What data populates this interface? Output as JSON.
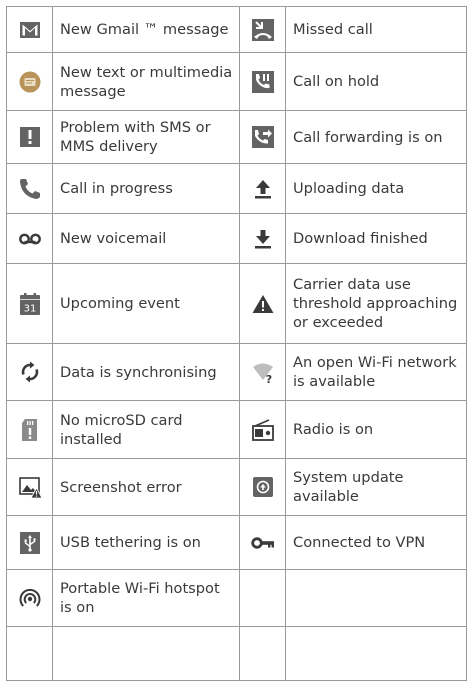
{
  "rows": [
    {
      "left": {
        "icon": "gmail-envelope-icon",
        "label": "New Gmail ™ message"
      },
      "right": {
        "icon": "missed-call-icon",
        "label": "Missed call"
      }
    },
    {
      "left": {
        "icon": "text-message-bubble-icon",
        "label": "New text or multimedia message"
      },
      "right": {
        "icon": "call-on-hold-icon",
        "label": "Call on hold"
      }
    },
    {
      "left": {
        "icon": "sms-problem-exclamation-icon",
        "label": "Problem with SMS or MMS delivery"
      },
      "right": {
        "icon": "call-forwarding-icon",
        "label": "Call forwarding is on"
      }
    },
    {
      "left": {
        "icon": "call-in-progress-icon",
        "label": "Call in progress"
      },
      "right": {
        "icon": "upload-arrow-icon",
        "label": "Uploading data"
      }
    },
    {
      "left": {
        "icon": "voicemail-icon",
        "label": "New voicemail"
      },
      "right": {
        "icon": "download-arrow-icon",
        "label": "Download finished"
      }
    },
    {
      "left": {
        "icon": "calendar-event-icon",
        "label": "Upcoming event",
        "icon_text": "31"
      },
      "right": {
        "icon": "warning-triangle-icon",
        "label": "Carrier data use threshold approaching or exceeded"
      }
    },
    {
      "left": {
        "icon": "sync-icon",
        "label": "Data is synchronising"
      },
      "right": {
        "icon": "open-wifi-icon",
        "label": "An open Wi-Fi network is available"
      }
    },
    {
      "left": {
        "icon": "no-sd-card-icon",
        "label": "No microSD card installed"
      },
      "right": {
        "icon": "radio-icon",
        "label": "Radio is on"
      }
    },
    {
      "left": {
        "icon": "screenshot-error-icon",
        "label": "Screenshot error"
      },
      "right": {
        "icon": "system-update-icon",
        "label": "System update available"
      }
    },
    {
      "left": {
        "icon": "usb-tethering-icon",
        "label": "USB tethering is on"
      },
      "right": {
        "icon": "vpn-key-icon",
        "label": "Connected to VPN"
      }
    },
    {
      "left": {
        "icon": "wifi-hotspot-icon",
        "label": "Portable Wi-Fi hotspot is on"
      },
      "right": {
        "icon": "",
        "label": ""
      }
    },
    {
      "left": {
        "icon": "",
        "label": ""
      },
      "right": {
        "icon": "",
        "label": ""
      }
    }
  ],
  "colors": {
    "icon_gray": "#636363",
    "border": "#9a9a9a",
    "text": "#3a3a3a",
    "sms_bubble": "#b8945a"
  }
}
